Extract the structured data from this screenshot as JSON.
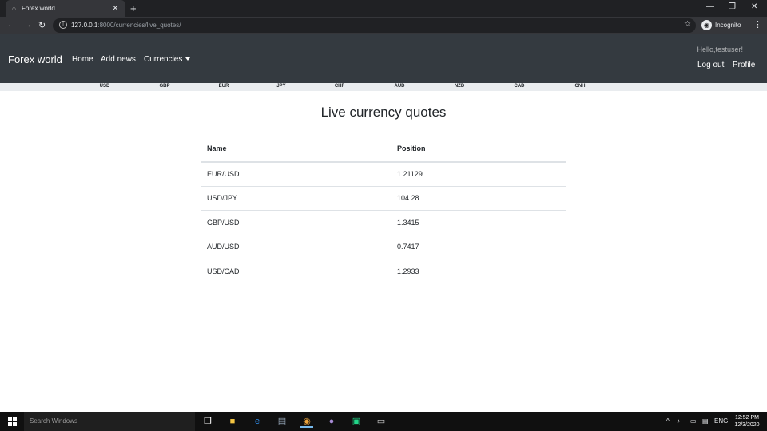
{
  "browser": {
    "tab_title": "Forex world",
    "tab_close": "✕",
    "new_tab": "+",
    "url_host": "127.0.0.1",
    "url_rest": ":8000/currencies/live_quotes/",
    "profile_label": "Incognito",
    "back": "←",
    "forward": "→",
    "reload": "↻",
    "bookmark": "☆",
    "menu": "⋮",
    "minimize": "—",
    "restore": "❐",
    "close": "✕"
  },
  "navbar": {
    "brand": "Forex world",
    "links": [
      "Home",
      "Add news",
      "Currencies"
    ],
    "greeting": "Hello,testuser!",
    "logout": "Log out",
    "profile": "Profile"
  },
  "currencies": [
    "USD",
    "GBP",
    "EUR",
    "JPY",
    "CHF",
    "AUD",
    "NZD",
    "CAD",
    "CNH"
  ],
  "main": {
    "title": "Live currency quotes",
    "columns": [
      "Name",
      "Position"
    ],
    "rows": [
      [
        "EUR/USD",
        "1.21129"
      ],
      [
        "USD/JPY",
        "104.28"
      ],
      [
        "GBP/USD",
        "1.3415"
      ],
      [
        "AUD/USD",
        "0.7417"
      ],
      [
        "USD/CAD",
        "1.2933"
      ]
    ]
  },
  "taskbar": {
    "search_placeholder": "Search Windows",
    "language": "ENG",
    "time": "12:52 PM",
    "date": "12/3/2020"
  },
  "colors": {
    "navbar_bg": "#343a40",
    "chrome_bg": "#202124",
    "table_border": "#dee2e6"
  }
}
